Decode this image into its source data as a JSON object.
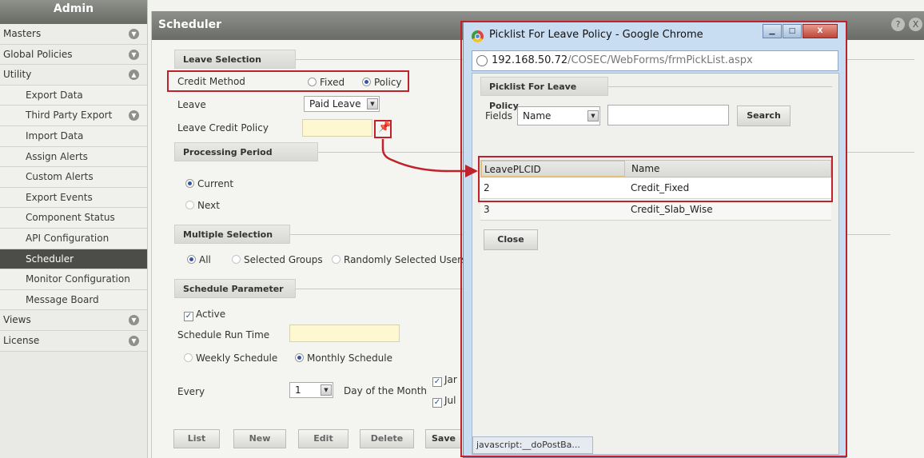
{
  "sidebar": {
    "title": "Admin",
    "items": [
      {
        "label": "Masters",
        "icon": "chevron-down-icon"
      },
      {
        "label": "Global Policies",
        "icon": "chevron-down-icon"
      },
      {
        "label": "Utility",
        "icon": "chevron-up-icon"
      },
      {
        "label": "Export Data"
      },
      {
        "label": "Third Party Export",
        "icon": "chevron-down-icon"
      },
      {
        "label": "Import Data"
      },
      {
        "label": "Assign Alerts"
      },
      {
        "label": "Custom Alerts"
      },
      {
        "label": "Export Events"
      },
      {
        "label": "Component Status"
      },
      {
        "label": "API Configuration"
      },
      {
        "label": "Scheduler"
      },
      {
        "label": "Monitor Configuration"
      },
      {
        "label": "Message Board"
      },
      {
        "label": "Views",
        "icon": "chevron-down-icon"
      },
      {
        "label": "License",
        "icon": "chevron-down-icon"
      }
    ]
  },
  "main": {
    "title": "Scheduler",
    "help_icon": "?",
    "close_icon": "X",
    "leave_selection": {
      "section": "Leave Selection",
      "credit_method_label": "Credit Method",
      "fixed_label": "Fixed",
      "policy_label": "Policy",
      "leave_label": "Leave",
      "leave_value": "Paid Leave",
      "leave_credit_policy_label": "Leave Credit Policy"
    },
    "processing_period": {
      "section": "Processing Period",
      "current_label": "Current",
      "next_label": "Next"
    },
    "multiple_selection": {
      "section": "Multiple Selection",
      "all_label": "All",
      "selected_groups_label": "Selected Groups",
      "random_users_label": "Randomly Selected Users"
    },
    "schedule_parameter": {
      "section": "Schedule Parameter",
      "active_label": "Active",
      "run_time_label": "Schedule Run Time",
      "weekly_label": "Weekly Schedule",
      "monthly_label": "Monthly Schedule",
      "every_label": "Every",
      "day_value": "1",
      "day_of_month_label": "Day of the Month",
      "month_check_1": "Jar",
      "month_check_2": "Jul"
    },
    "buttons": {
      "list": "List",
      "new": "New",
      "edit": "Edit",
      "delete": "Delete",
      "save": "Save"
    }
  },
  "popup": {
    "title": "Picklist For Leave Policy - Google Chrome",
    "url_host": "192.168.50.72",
    "url_path": "/COSEC/WebForms/frmPickList.aspx",
    "section": "Picklist For Leave Policy",
    "fields_label": "Fields",
    "fields_value": "Name",
    "search_button": "Search",
    "columns": [
      "LeavePLCID",
      "Name"
    ],
    "rows": [
      [
        "2",
        "Credit_Fixed"
      ],
      [
        "3",
        "Credit_Slab_Wise"
      ]
    ],
    "close_button": "Close",
    "status_text": "javascript:__doPostBa..."
  },
  "colors": {
    "highlight": "#c0222b",
    "accent": "#3556a8"
  }
}
